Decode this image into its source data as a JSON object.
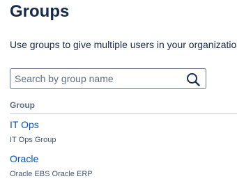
{
  "page": {
    "title": "Groups",
    "description": "Use groups to give multiple users in your organizatio"
  },
  "search": {
    "placeholder": "Search by group name",
    "value": "",
    "icon": "search-icon"
  },
  "table": {
    "header": "Group",
    "rows": [
      {
        "name": "IT Ops",
        "description": "IT Ops Group"
      },
      {
        "name": "Oracle",
        "description": "Oracle EBS Oracle ERP"
      }
    ]
  },
  "colors": {
    "text": "#172b4d",
    "link": "#0052cc",
    "muted": "#5e6c84",
    "border": "#6b778c",
    "divider": "#dfe1e6"
  }
}
